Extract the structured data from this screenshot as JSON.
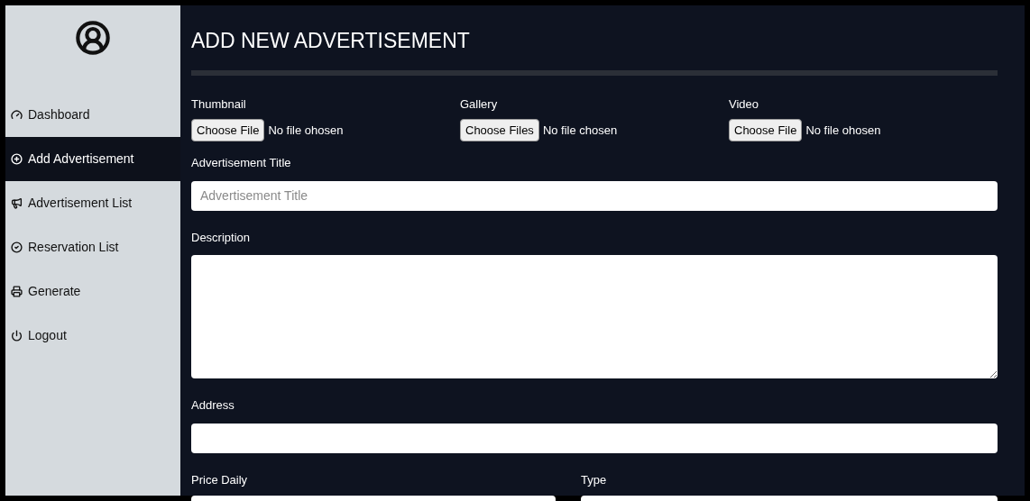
{
  "sidebar": {
    "items": [
      {
        "label": "Dashboard",
        "selected": false
      },
      {
        "label": "Add Advertisement",
        "selected": true
      },
      {
        "label": "Advertisement List",
        "selected": false
      },
      {
        "label": "Reservation List",
        "selected": false
      },
      {
        "label": "Generate",
        "selected": false
      },
      {
        "label": "Logout",
        "selected": false
      }
    ]
  },
  "page_title": "ADD NEW ADVERTISEMENT",
  "file_inputs": [
    {
      "label": "Thumbnail",
      "button": "Choose File",
      "status": "No file ohosen"
    },
    {
      "label": "Gallery",
      "button": "Choose Files",
      "status": "No file chosen"
    },
    {
      "label": "Video",
      "button": "Choose File",
      "status": "No file ohosen"
    }
  ],
  "title_field": {
    "label": "Advertisement Title",
    "placeholder": "Advertisement Title"
  },
  "description_field": {
    "label": "Description"
  },
  "address_field": {
    "label": "Address"
  },
  "bottom_fields": [
    {
      "label": "Price Daily"
    },
    {
      "label": "Type"
    }
  ]
}
